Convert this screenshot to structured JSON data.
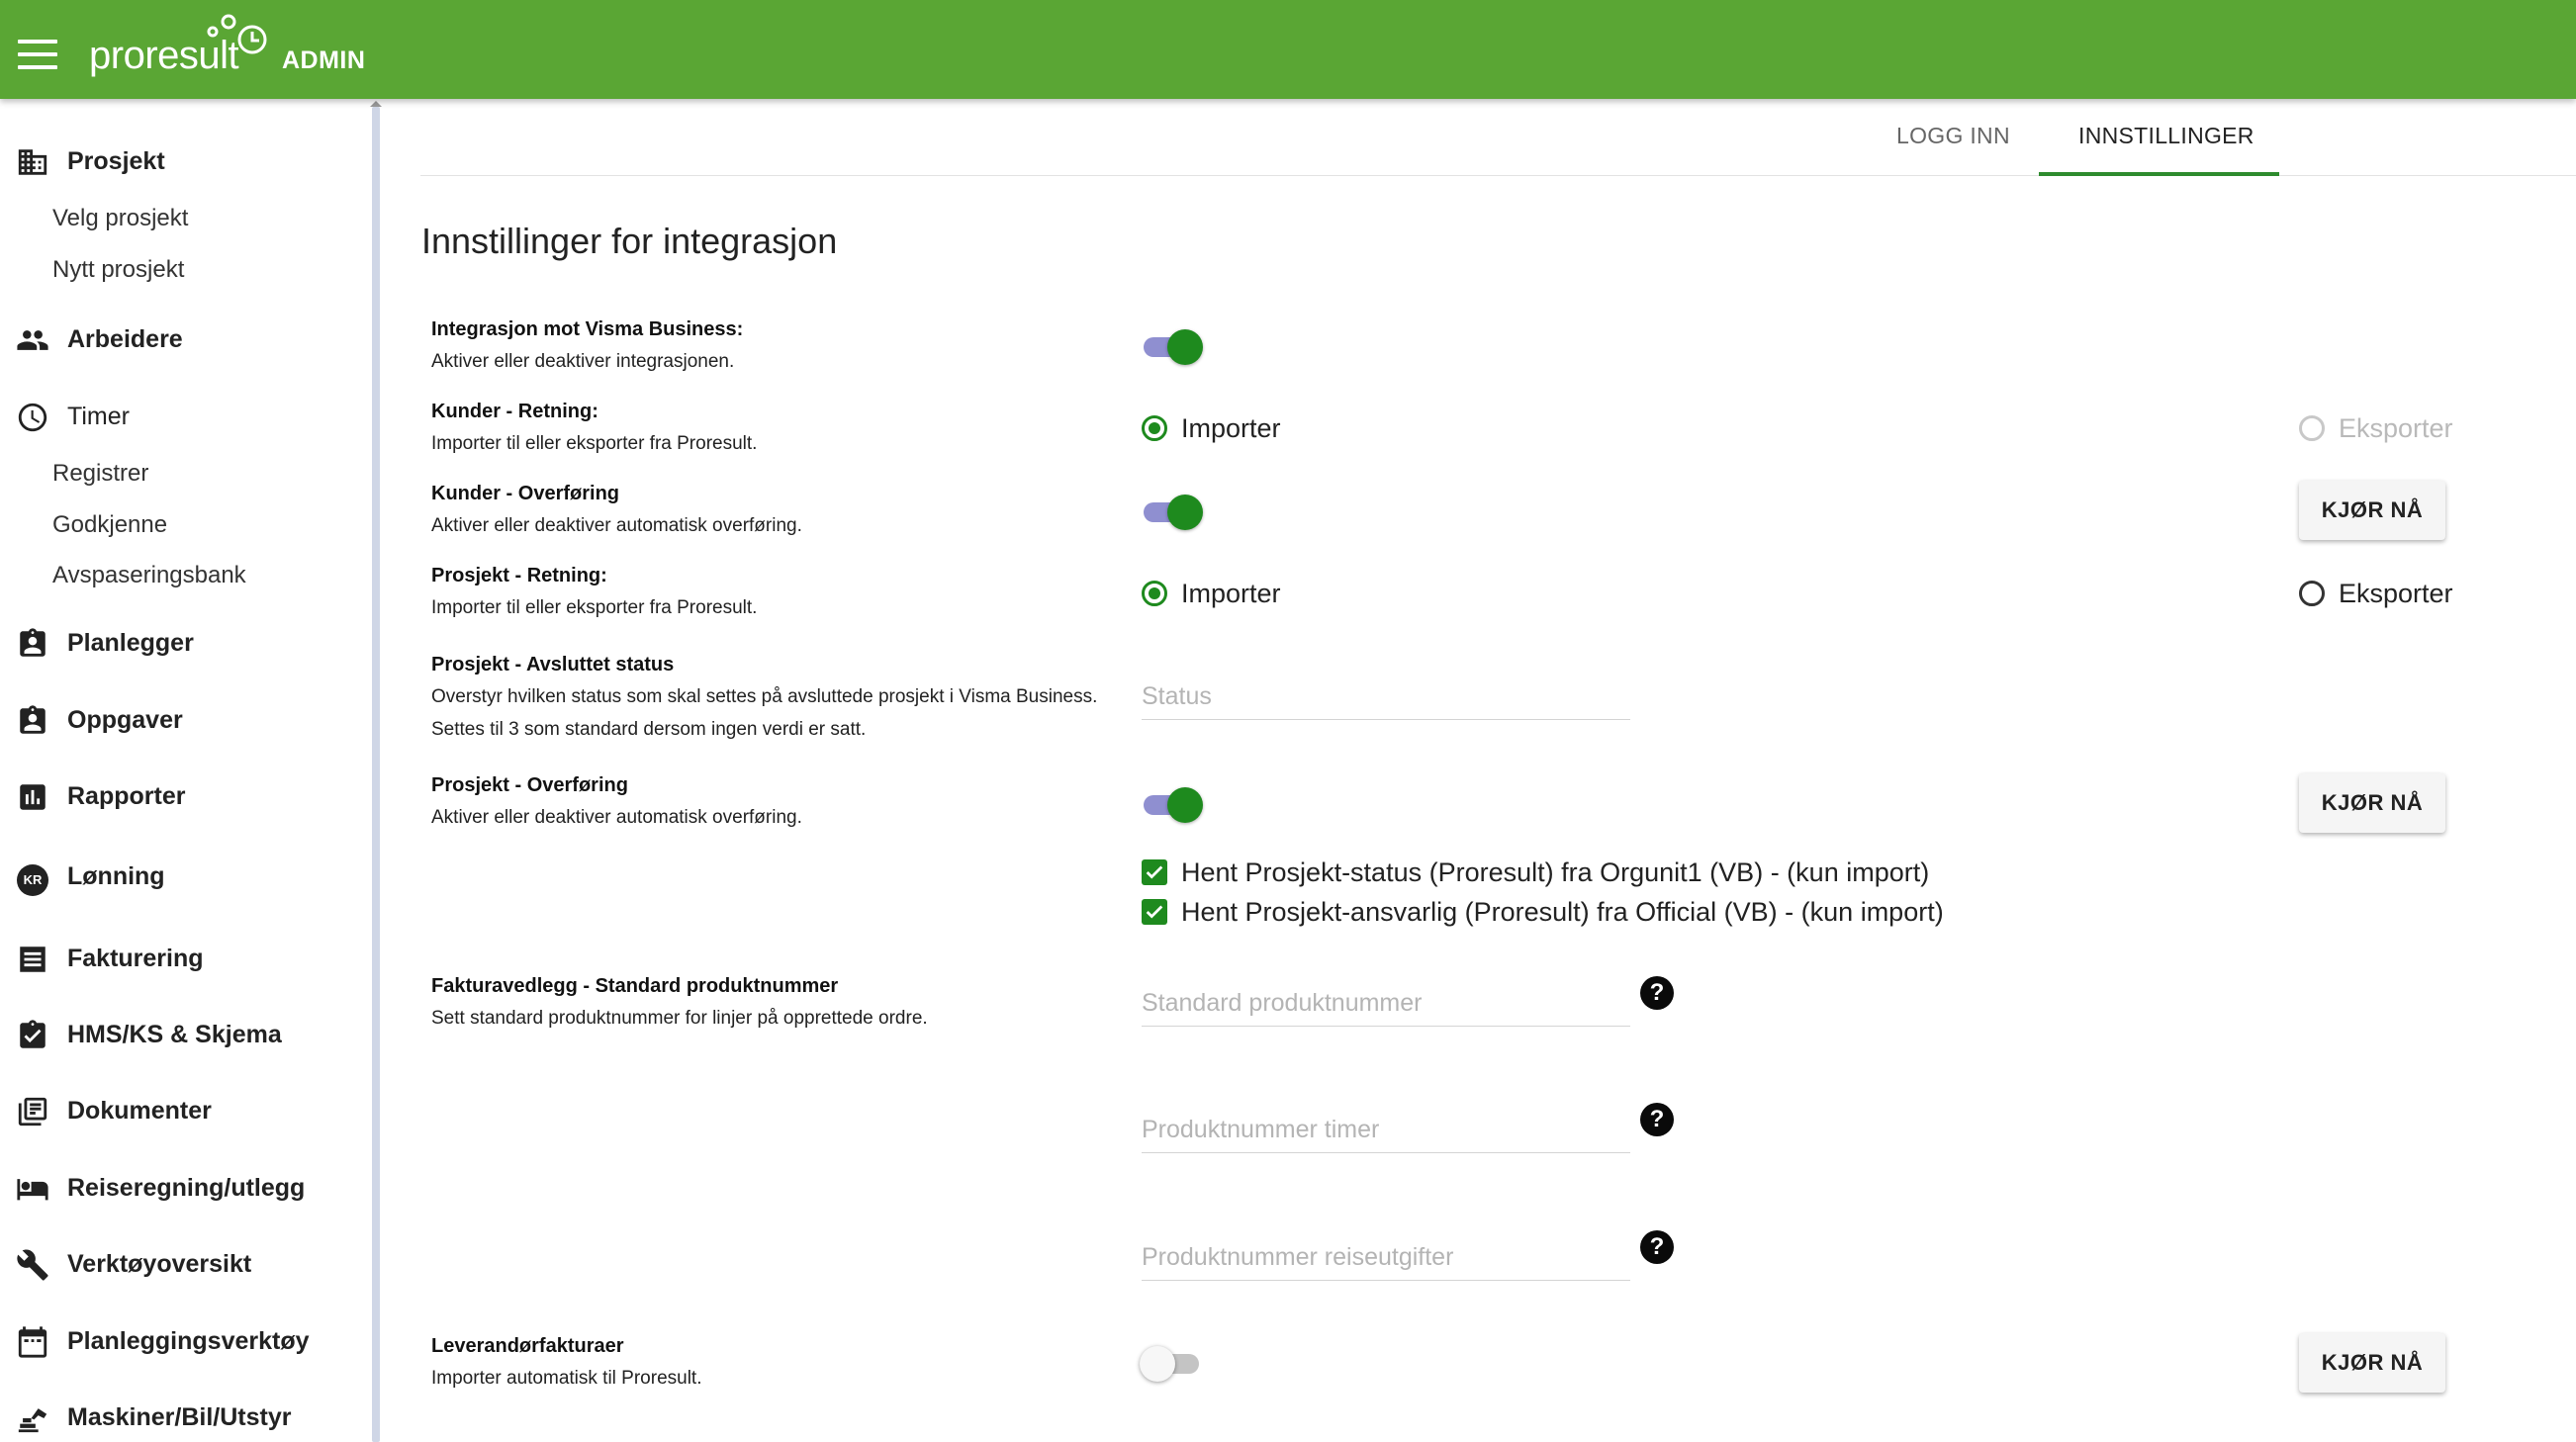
{
  "header": {
    "logo_text": "proresult",
    "admin_label": "ADMIN"
  },
  "sidebar": {
    "sections": [
      {
        "label": "Prosjekt",
        "icon": "building-icon",
        "items": [
          "Velg prosjekt",
          "Nytt prosjekt"
        ]
      },
      {
        "label": "Arbeidere",
        "icon": "people-icon",
        "items": []
      },
      {
        "label": "Timer",
        "icon": "clock-icon",
        "items": [
          "Registrer",
          "Godkjenne",
          "Avspaseringsbank"
        ]
      },
      {
        "label": "Planlegger",
        "icon": "badge-icon",
        "items": []
      },
      {
        "label": "Oppgaver",
        "icon": "assignment-icon",
        "items": []
      },
      {
        "label": "Rapporter",
        "icon": "bar-chart-icon",
        "items": []
      },
      {
        "label": "Lønning",
        "icon": "kr-coin-icon",
        "icon_text": "KR",
        "items": []
      },
      {
        "label": "Fakturering",
        "icon": "list-icon",
        "items": []
      },
      {
        "label": "HMS/KS & Skjema",
        "icon": "checklist-icon",
        "items": []
      },
      {
        "label": "Dokumenter",
        "icon": "library-books-icon",
        "items": []
      },
      {
        "label": "Reiseregning/utlegg",
        "icon": "bed-icon",
        "items": []
      },
      {
        "label": "Verktøyoversikt",
        "icon": "wrench-icon",
        "items": []
      },
      {
        "label": "Planleggingsverktøy",
        "icon": "calendar-icon",
        "items": []
      },
      {
        "label": "Maskiner/Bil/Utstyr",
        "icon": "excavator-icon",
        "items": []
      }
    ]
  },
  "tabs": [
    {
      "label": "LOGG INN",
      "active": false
    },
    {
      "label": "INNSTILLINGER",
      "active": true
    }
  ],
  "page_title": "Innstillinger for integrasjon",
  "settings": {
    "visma": {
      "title": "Integrasjon mot Visma Business:",
      "desc": "Aktiver eller deaktiver integrasjonen.",
      "enabled": true
    },
    "kunder_retning": {
      "title": "Kunder - Retning:",
      "desc": "Importer til eller eksporter fra Proresult.",
      "opt_import": "Importer",
      "opt_export": "Eksporter",
      "selected": "Importer",
      "export_disabled": true
    },
    "kunder_overforing": {
      "title": "Kunder - Overføring",
      "desc": "Aktiver eller deaktiver automatisk overføring.",
      "enabled": true,
      "button": "KJØR NÅ"
    },
    "prosjekt_retning": {
      "title": "Prosjekt - Retning:",
      "desc": "Importer til eller eksporter fra Proresult.",
      "opt_import": "Importer",
      "opt_export": "Eksporter",
      "selected": "Importer"
    },
    "prosjekt_status": {
      "title": "Prosjekt - Avsluttet status",
      "desc1": "Overstyr hvilken status som skal settes på avsluttede prosjekt i Visma Business.",
      "desc2": "Settes til 3 som standard dersom ingen verdi er satt.",
      "placeholder": "Status",
      "value": ""
    },
    "prosjekt_overforing": {
      "title": "Prosjekt - Overføring",
      "desc": "Aktiver eller deaktiver automatisk overføring.",
      "enabled": true,
      "button": "KJØR NÅ",
      "checks": [
        {
          "label": "Hent Prosjekt-status (Proresult) fra Orgunit1 (VB) - (kun import)",
          "checked": true
        },
        {
          "label": "Hent Prosjekt-ansvarlig (Proresult) fra Official (VB) - (kun import)",
          "checked": true
        }
      ]
    },
    "fakturavedlegg": {
      "title": "Fakturavedlegg - Standard produktnummer",
      "desc": "Sett standard produktnummer for linjer på opprettede ordre.",
      "fields": [
        {
          "placeholder": "Standard produktnummer"
        },
        {
          "placeholder": "Produktnummer timer"
        },
        {
          "placeholder": "Produktnummer reiseutgifter"
        }
      ],
      "help_symbol": "?"
    },
    "leverandor": {
      "title": "Leverandørfakturaer",
      "desc": "Importer automatisk til Proresult.",
      "enabled": false,
      "button": "KJØR NÅ"
    }
  },
  "colors": {
    "header_green": "#5aa634",
    "accent_green": "#1e8a1e",
    "switch_track": "#8f8fd0"
  }
}
